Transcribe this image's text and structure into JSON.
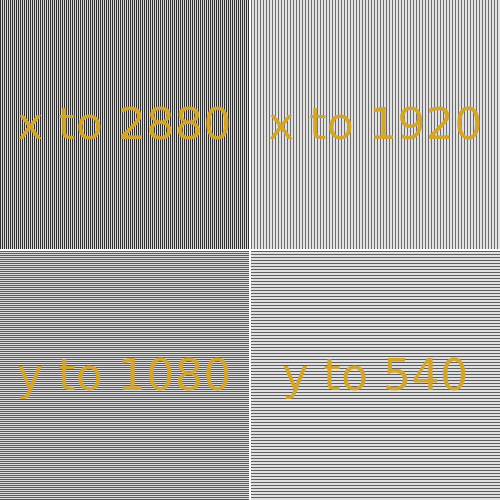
{
  "colors": {
    "label_color": "#d4a52c",
    "divider": "#ffffff"
  },
  "quadrants": [
    {
      "label": "x to 2880",
      "pattern": "vertical-lines"
    },
    {
      "label": "x to 1920",
      "pattern": "vertical-lines"
    },
    {
      "label": "y to 1080",
      "pattern": "horizontal-lines"
    },
    {
      "label": "y to 540",
      "pattern": "horizontal-lines"
    }
  ]
}
